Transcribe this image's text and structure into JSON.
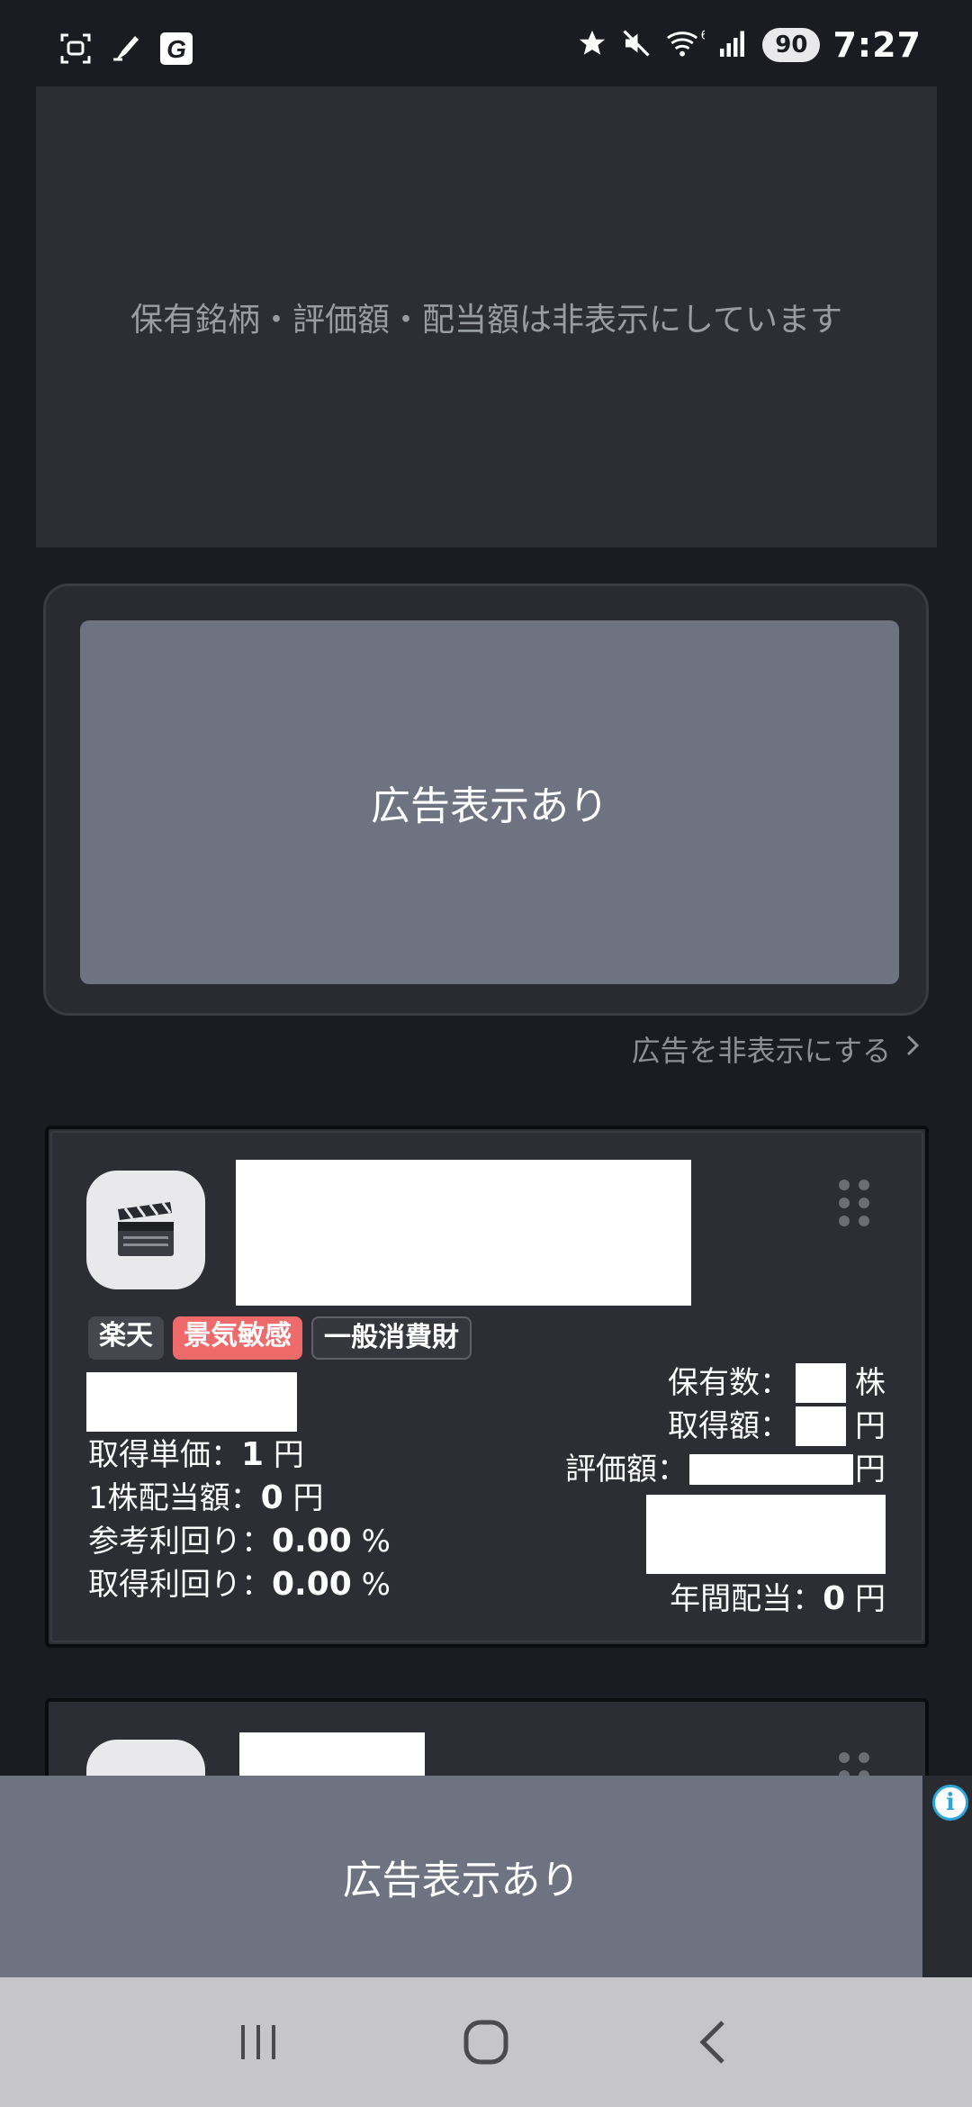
{
  "status_bar": {
    "time": "7:27",
    "battery": "90",
    "icons": [
      "screenshot-icon",
      "pen-app-icon",
      "g-app-icon",
      "star-icon",
      "mute-icon",
      "wifi-icon",
      "signal-icon"
    ]
  },
  "hidden_panel": {
    "message": "保有銘柄・評価額・配当額は非表示にしています"
  },
  "ad": {
    "label": "広告表示あり",
    "hide_link": "広告を非表示にする"
  },
  "stock": {
    "icon": "clapperboard-icon",
    "tags": [
      "楽天",
      "景気敏感",
      "一般消費財"
    ],
    "acq_unit_label": "取得単価：",
    "acq_unit_value": "1",
    "acq_unit_suffix": "円",
    "div_label": "1株配当額：",
    "div_value": "0",
    "div_suffix": "円",
    "ref_yield_label": "参考利回り：",
    "ref_yield_value": "0.00",
    "ref_yield_suffix": "%",
    "acq_yield_label": "取得利回り：",
    "acq_yield_value": "0.00",
    "acq_yield_suffix": "%",
    "holdings_label": "保有数：",
    "holdings_suffix": "株",
    "acq_amount_label": "取得額：",
    "acq_amount_suffix": "円",
    "valuation_label": "評価額：",
    "valuation_suffix": "円",
    "annual_div_label": "年間配当：",
    "annual_div_value": "0",
    "annual_div_suffix": "円"
  },
  "bottom_ad": {
    "label": "広告表示あり",
    "info_icon": "info-icon"
  },
  "nav_bar": {
    "buttons": [
      "recent-apps-icon",
      "home-icon",
      "back-icon"
    ]
  },
  "colors": {
    "background": "#1b1c21",
    "panel": "#2d2e33",
    "ad_fill": "#6d7380",
    "tag_red": "#ef6b6b"
  }
}
